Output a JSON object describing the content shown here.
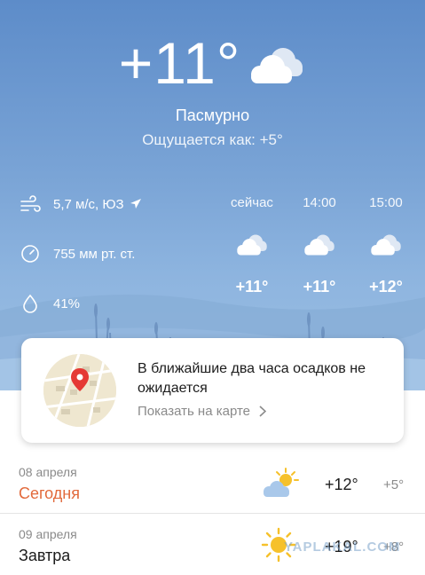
{
  "current": {
    "temperature": "+11°",
    "condition": "Пасмурно",
    "feels_like": "Ощущается как: +5°"
  },
  "details": {
    "wind": "5,7 м/с, ЮЗ",
    "pressure": "755 мм рт. ст.",
    "humidity": "41%"
  },
  "hourly": [
    {
      "time": "сейчас",
      "temp": "+11°",
      "icon": "cloud-icon"
    },
    {
      "time": "14:00",
      "temp": "+11°",
      "icon": "cloud-icon"
    },
    {
      "time": "15:00",
      "temp": "+12°",
      "icon": "cloud-icon"
    }
  ],
  "precip_card": {
    "title": "В ближайшие два часа осадков не ожидается",
    "link": "Показать на карте"
  },
  "days": [
    {
      "date": "08 апреля",
      "name": "Сегодня",
      "hi": "+12°",
      "lo": "+5°",
      "icon": "partly-cloudy-icon"
    },
    {
      "date": "09 апреля",
      "name": "Завтра",
      "hi": "+19°",
      "lo": "+8°",
      "icon": "sun-icon"
    }
  ],
  "watermark": "YAPLAKAL.COM",
  "colors": {
    "accent_today": "#e26a3c",
    "sky": "#6f9bd1",
    "sun": "#f6c12b"
  }
}
